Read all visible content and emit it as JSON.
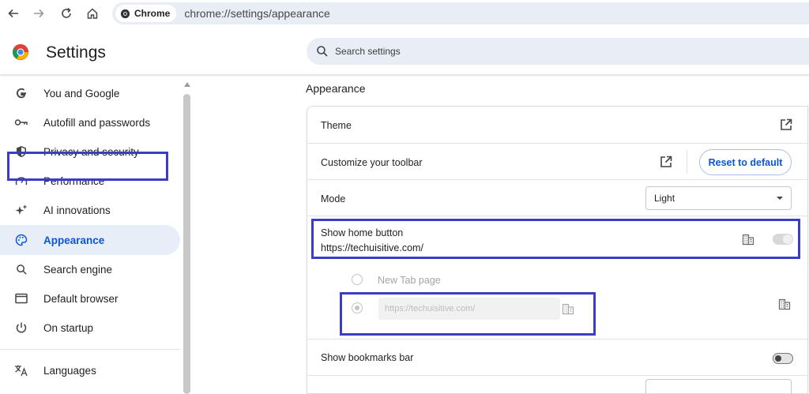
{
  "browser": {
    "chip_label": "Chrome",
    "url": "chrome://settings/appearance"
  },
  "header": {
    "title": "Settings",
    "search_placeholder": "Search settings"
  },
  "sidebar": {
    "items": [
      {
        "label": "You and Google",
        "icon": "google-icon"
      },
      {
        "label": "Autofill and passwords",
        "icon": "key-icon"
      },
      {
        "label": "Privacy and security",
        "icon": "shield-icon"
      },
      {
        "label": "Performance",
        "icon": "speedometer-icon"
      },
      {
        "label": "AI innovations",
        "icon": "sparkle-icon"
      },
      {
        "label": "Appearance",
        "icon": "palette-icon",
        "active": true
      },
      {
        "label": "Search engine",
        "icon": "search-icon"
      },
      {
        "label": "Default browser",
        "icon": "browser-window-icon"
      },
      {
        "label": "On startup",
        "icon": "power-icon"
      },
      {
        "label": "Languages",
        "icon": "translate-icon"
      }
    ]
  },
  "main": {
    "section_title": "Appearance",
    "rows": {
      "theme": {
        "label": "Theme"
      },
      "toolbar": {
        "label": "Customize your toolbar",
        "reset_label": "Reset to default"
      },
      "mode": {
        "label": "Mode",
        "value": "Light"
      },
      "home_button": {
        "label": "Show home button",
        "sub": "https://techuisitive.com/",
        "enabled": true,
        "managed": true
      },
      "new_tab_option": {
        "label": "New Tab page",
        "checked": false
      },
      "custom_url_option": {
        "placeholder": "https://techuisitive.com/",
        "checked": true
      },
      "bookmarks_bar": {
        "label": "Show bookmarks bar",
        "enabled": false
      }
    }
  },
  "colors": {
    "accent": "#0b57d0",
    "highlight_box": "#3b3ec0",
    "active_nav_bg": "#e8eef8"
  }
}
